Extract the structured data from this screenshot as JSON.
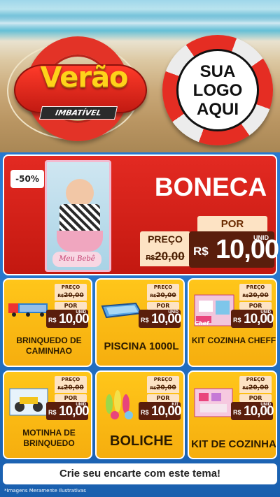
{
  "header": {
    "title": "Verão",
    "subtitle": "IMBATÍVEL",
    "logo_lines": [
      "SUA",
      "LOGO",
      "AQUI"
    ]
  },
  "featured": {
    "discount": "-50%",
    "box_brand": "Meu Bebê",
    "title": "BONECA",
    "price_label": "PREÇO",
    "old_currency": "R$",
    "old_price": "20,00",
    "por_label": "POR",
    "unit": "UNID",
    "currency": "R$",
    "price": "10,00"
  },
  "products": [
    {
      "name": "BRINQUEDO DE CAMINHAO",
      "price_label": "PREÇO",
      "old_currency": "R$",
      "old_price": "20,00",
      "por_label": "POR",
      "unit": "UNID",
      "currency": "R$",
      "price": "10,00"
    },
    {
      "name": "PISCINA 1000L",
      "price_label": "PREÇO",
      "old_currency": "R$",
      "old_price": "20,00",
      "por_label": "POR",
      "unit": "UNID",
      "currency": "R$",
      "price": "10,00"
    },
    {
      "name": "KIT COZINHA CHEFF",
      "price_label": "PREÇO",
      "old_currency": "R$",
      "old_price": "20,00",
      "por_label": "POR",
      "unit": "UNID",
      "currency": "R$",
      "price": "10,00",
      "box_label": "Chef"
    },
    {
      "name": "MOTINHA DE BRINQUEDO",
      "price_label": "PREÇO",
      "old_currency": "R$",
      "old_price": "20,00",
      "por_label": "POR",
      "unit": "UNID",
      "currency": "R$",
      "price": "10,00"
    },
    {
      "name": "BOLICHE",
      "price_label": "PREÇO",
      "old_currency": "R$",
      "old_price": "20,00",
      "por_label": "POR",
      "unit": "KIT",
      "currency": "R$",
      "price": "10,00"
    },
    {
      "name": "KIT DE COZINHA",
      "price_label": "PREÇO",
      "old_currency": "R$",
      "old_price": "20,00",
      "por_label": "POR",
      "unit": "UNID",
      "currency": "R$",
      "price": "10,00"
    }
  ],
  "footer": {
    "cta": "Crie seu encarte com este tema!",
    "disclaimer": "*Imagens Meramente Ilustrativas"
  },
  "colors": {
    "main_red": "#e32a22",
    "card_yellow": "#ffc61a",
    "price_brown": "#5a1e0c",
    "label_cream": "#fde3c4"
  }
}
